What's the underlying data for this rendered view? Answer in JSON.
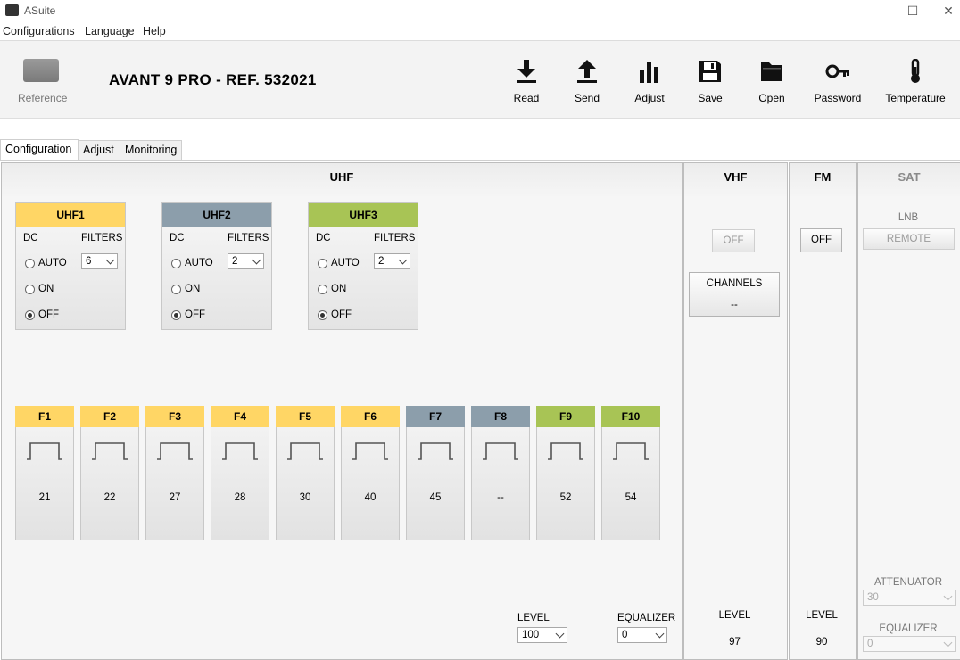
{
  "window": {
    "title": "ASuite",
    "minimize": "—",
    "maximize": "☐",
    "close": "✕"
  },
  "menu": [
    "Configurations",
    "Language",
    "Help"
  ],
  "toolbar": {
    "reference_label": "Reference",
    "device_title": "AVANT 9  PRO - REF. 532021",
    "actions": [
      {
        "label": "Read",
        "icon": "download-icon"
      },
      {
        "label": "Send",
        "icon": "upload-icon"
      },
      {
        "label": "Adjust",
        "icon": "bar-chart-icon"
      },
      {
        "label": "Save",
        "icon": "floppy-disk-icon"
      },
      {
        "label": "Open",
        "icon": "folder-icon"
      },
      {
        "label": "Password",
        "icon": "key-icon"
      },
      {
        "label": "Temperature",
        "icon": "thermometer-icon"
      }
    ]
  },
  "tabs": [
    {
      "label": "Configuration",
      "active": true
    },
    {
      "label": "Adjust",
      "active": false
    },
    {
      "label": "Monitoring",
      "active": false
    }
  ],
  "uhf": {
    "title": "UHF",
    "dc_label": "DC",
    "filters_label": "FILTERS",
    "options": [
      "AUTO",
      "ON",
      "OFF"
    ],
    "inputs": [
      {
        "name": "UHF1",
        "color": "#ffd665",
        "filters": "6",
        "selected": "OFF"
      },
      {
        "name": "UHF2",
        "color": "#8c9eab",
        "filters": "2",
        "selected": "OFF"
      },
      {
        "name": "UHF3",
        "color": "#a8c455",
        "filters": "2",
        "selected": "OFF"
      }
    ],
    "filters": [
      {
        "name": "F1",
        "color": "#ffd665",
        "value": "21"
      },
      {
        "name": "F2",
        "color": "#ffd665",
        "value": "22"
      },
      {
        "name": "F3",
        "color": "#ffd665",
        "value": "27"
      },
      {
        "name": "F4",
        "color": "#ffd665",
        "value": "28"
      },
      {
        "name": "F5",
        "color": "#ffd665",
        "value": "30"
      },
      {
        "name": "F6",
        "color": "#ffd665",
        "value": "40"
      },
      {
        "name": "F7",
        "color": "#8c9eab",
        "value": "45"
      },
      {
        "name": "F8",
        "color": "#8c9eab",
        "value": "--"
      },
      {
        "name": "F9",
        "color": "#a8c455",
        "value": "52"
      },
      {
        "name": "F10",
        "color": "#a8c455",
        "value": "54"
      }
    ],
    "level_label": "LEVEL",
    "level_value": "100",
    "equalizer_label": "EQUALIZER",
    "equalizer_value": "0"
  },
  "vhf": {
    "title": "VHF",
    "off_button": "OFF",
    "channels_label": "CHANNELS",
    "channels_value": "--",
    "level_label": "LEVEL",
    "level_value": "97"
  },
  "fm": {
    "title": "FM",
    "off_button": "OFF",
    "level_label": "LEVEL",
    "level_value": "90"
  },
  "sat": {
    "title": "SAT",
    "lnb_label": "LNB",
    "remote_button": "REMOTE",
    "attenuator_label": "ATTENUATOR",
    "attenuator_value": "30",
    "equalizer_label": "EQUALIZER",
    "equalizer_value": "0"
  }
}
